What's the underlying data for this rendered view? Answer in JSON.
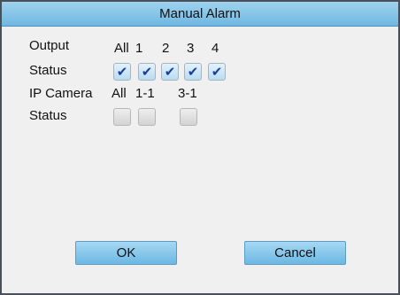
{
  "dialog": {
    "title": "Manual Alarm"
  },
  "output": {
    "label": "Output",
    "columns": [
      "All",
      "1",
      "2",
      "3",
      "4"
    ],
    "status_label": "Status",
    "checked": [
      true,
      true,
      true,
      true,
      true
    ]
  },
  "ip_camera": {
    "label": "IP Camera",
    "columns": [
      "All",
      "1-1",
      "3-1"
    ],
    "status_label": "Status",
    "checked": [
      false,
      false,
      false
    ]
  },
  "buttons": {
    "ok": "OK",
    "cancel": "Cancel"
  },
  "icons": {
    "check": "checkmark-icon"
  },
  "colors": {
    "accent": "#7fc3ea",
    "check": "#1d3c9a"
  }
}
